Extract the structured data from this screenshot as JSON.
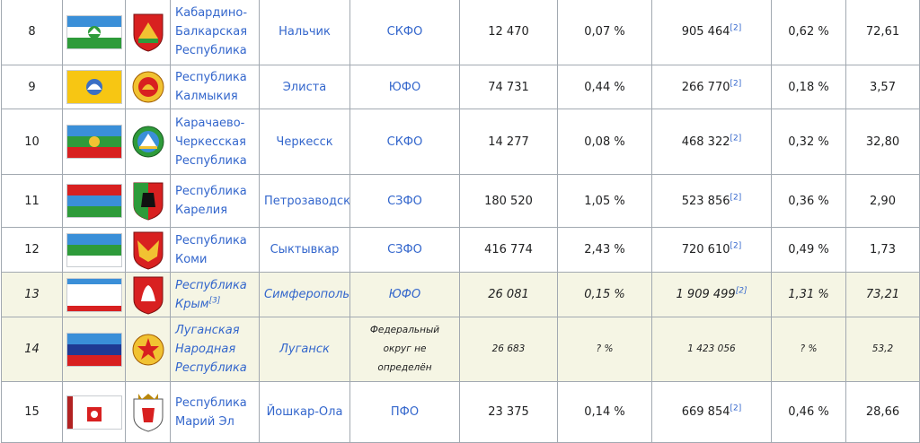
{
  "rows": [
    {
      "num": "8",
      "name": "Кабардино-Балкарская Республика",
      "name_ref": "",
      "capital": "Нальчик",
      "district": "СКФО",
      "area": "12 470",
      "area_pct": "0,07 %",
      "population": "905 464",
      "pop_ref": "[2]",
      "pop_pct": "0,62 %",
      "density": "72,61",
      "flag_icon": "kabardino-balkaria-flag-icon",
      "coat_icon": "kabardino-balkaria-coat-of-arms-icon"
    },
    {
      "num": "9",
      "name": "Республика Калмыкия",
      "name_ref": "",
      "capital": "Элиста",
      "district": "ЮФО",
      "area": "74 731",
      "area_pct": "0,44 %",
      "population": "266 770",
      "pop_ref": "[2]",
      "pop_pct": "0,18 %",
      "density": "3,57",
      "flag_icon": "kalmykia-flag-icon",
      "coat_icon": "kalmykia-coat-of-arms-icon"
    },
    {
      "num": "10",
      "name": "Карачаево-Черкесская Республика",
      "name_ref": "",
      "capital": "Черкесск",
      "district": "СКФО",
      "area": "14 277",
      "area_pct": "0,08 %",
      "population": "468 322",
      "pop_ref": "[2]",
      "pop_pct": "0,32 %",
      "density": "32,80",
      "flag_icon": "karachay-cherkessia-flag-icon",
      "coat_icon": "karachay-cherkessia-coat-of-arms-icon"
    },
    {
      "num": "11",
      "name": "Республика Карелия",
      "name_ref": "",
      "capital": "Петрозаводск",
      "district": "СЗФО",
      "area": "180 520",
      "area_pct": "1,05 %",
      "population": "523 856",
      "pop_ref": "[2]",
      "pop_pct": "0,36 %",
      "density": "2,90",
      "flag_icon": "karelia-flag-icon",
      "coat_icon": "karelia-coat-of-arms-icon"
    },
    {
      "num": "12",
      "name": "Республика Коми",
      "name_ref": "",
      "capital": "Сыктывкар",
      "district": "СЗФО",
      "area": "416 774",
      "area_pct": "2,43 %",
      "population": "720 610",
      "pop_ref": "[2]",
      "pop_pct": "0,49 %",
      "density": "1,73",
      "flag_icon": "komi-flag-icon",
      "coat_icon": "komi-coat-of-arms-icon"
    },
    {
      "num": "13",
      "name": "Республика Крым",
      "name_ref": "[3]",
      "capital": "Симферополь",
      "district": "ЮФО",
      "area": "26 081",
      "area_pct": "0,15 %",
      "population": "1 909 499",
      "pop_ref": "[2]",
      "pop_pct": "1,31 %",
      "density": "73,21",
      "flag_icon": "crimea-flag-icon",
      "coat_icon": "crimea-coat-of-arms-icon"
    },
    {
      "num": "14",
      "name": "Луганская Народная Республика",
      "name_ref": "",
      "capital": "Луганск",
      "district": "Федеральный округ не определён",
      "area": "26 683",
      "area_pct": "? %",
      "population": "1 423 056",
      "pop_ref": "",
      "pop_pct": "? %",
      "density": "53,2",
      "flag_icon": "lugansk-flag-icon",
      "coat_icon": "lugansk-coat-of-arms-icon"
    },
    {
      "num": "15",
      "name": "Республика Марий Эл",
      "name_ref": "",
      "capital": "Йошкар-Ола",
      "district": "ПФО",
      "area": "23 375",
      "area_pct": "0,14 %",
      "population": "669 854",
      "pop_ref": "[2]",
      "pop_pct": "0,46 %",
      "density": "28,66",
      "flag_icon": "mari-el-flag-icon",
      "coat_icon": "mari-el-coat-of-arms-icon"
    }
  ],
  "colors": {
    "link": "#3366cc",
    "border": "#a2a9b1",
    "shaded_row": "#f5f5e4",
    "text": "#202122"
  }
}
